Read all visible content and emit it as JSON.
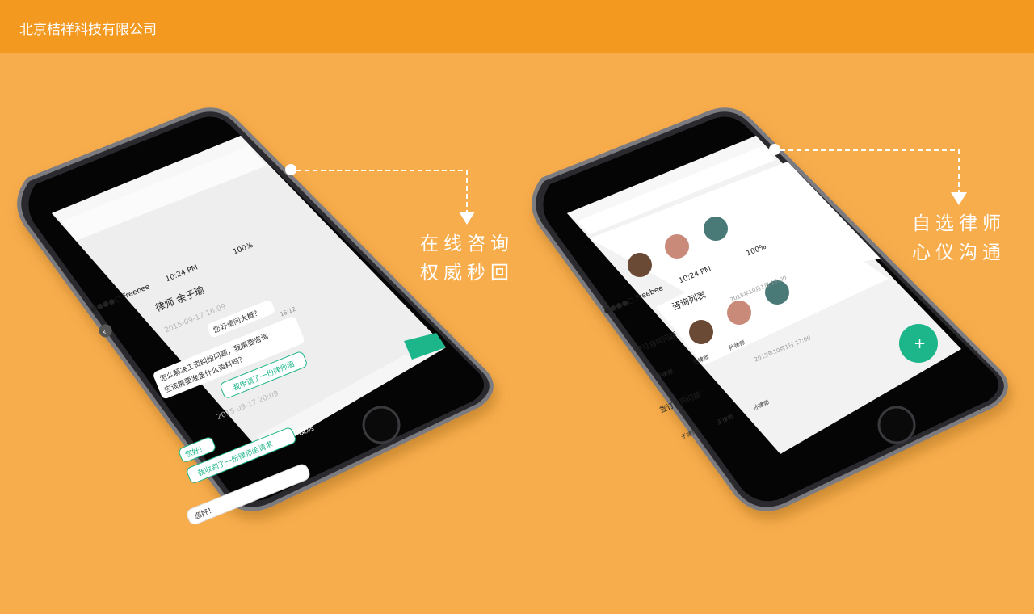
{
  "company": "北京桔祥科技有限公司",
  "captions": {
    "left_line1": "在线咨询",
    "left_line2": "权威秒回",
    "right_line1": "自选律师",
    "right_line2": "心仪沟通"
  },
  "chat_screen": {
    "status_carrier": "●●●●○ Freebee",
    "status_time": "10:24 PM",
    "status_battery": "100%",
    "title": "律师 余子瑜",
    "date1": "2015-09-17 16:09",
    "msg1": "您好请问大概？",
    "msg2a": "怎么解决工资纠纷问题，我需要咨询",
    "msg2b": "应该需要准备什么资料吗？",
    "msg2_time": "16:12",
    "file1": "我申请了一份律师函",
    "date2": "2015-09-17 20:09",
    "msg3": "您好！",
    "file2": "我收到了一份律师函请求",
    "send_label": "发送",
    "input_value": "您好！"
  },
  "list_screen": {
    "status_carrier": "●●●●○ Freebee",
    "status_time": "10:24 PM",
    "status_battery": "100%",
    "title": "咨询列表",
    "items": [
      {
        "title": "签订合同问题",
        "date": "2015年10月1日 17:00",
        "lawyers": [
          "于律师",
          "王律师",
          "孙律师"
        ]
      },
      {
        "title": "签订合同问题",
        "date": "2015年10月1日 17:00",
        "lawyers": [
          "于律师",
          "王律师",
          "孙律师"
        ]
      }
    ],
    "fab_label": "+"
  }
}
